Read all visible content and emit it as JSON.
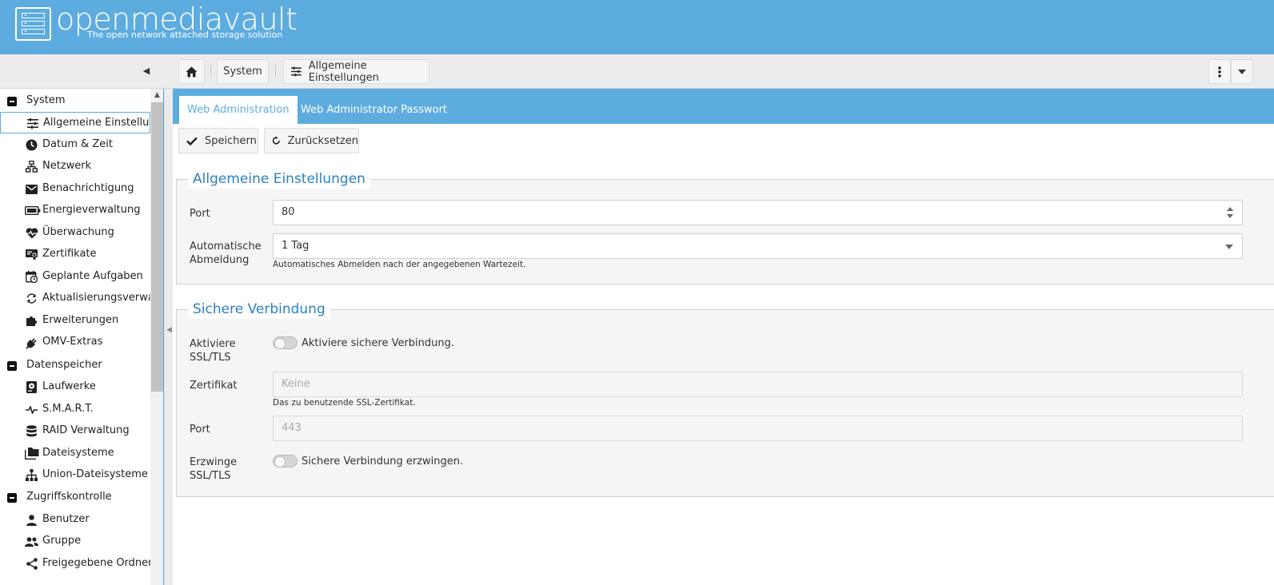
{
  "brand": {
    "name": "openmediavault",
    "tagline": "The open network attached storage solution"
  },
  "breadcrumb": {
    "section": "System",
    "page": "Allgemeine Einstellungen"
  },
  "sidebar": {
    "groups": [
      {
        "label": "System",
        "items": [
          {
            "label": "Allgemeine Einstellungen",
            "icon": "sliders-icon",
            "active": true
          },
          {
            "label": "Datum & Zeit",
            "icon": "clock-icon"
          },
          {
            "label": "Netzwerk",
            "icon": "network-icon"
          },
          {
            "label": "Benachrichtigung",
            "icon": "envelope-icon"
          },
          {
            "label": "Energieverwaltung",
            "icon": "battery-icon"
          },
          {
            "label": "Überwachung",
            "icon": "heartbeat-icon"
          },
          {
            "label": "Zertifikate",
            "icon": "certificate-icon"
          },
          {
            "label": "Geplante Aufgaben",
            "icon": "calendar-clock-icon"
          },
          {
            "label": "Aktualisierungsverwaltung",
            "icon": "refresh-icon"
          },
          {
            "label": "Erweiterungen",
            "icon": "puzzle-icon"
          },
          {
            "label": "OMV-Extras",
            "icon": "plug-icon"
          }
        ]
      },
      {
        "label": "Datenspeicher",
        "items": [
          {
            "label": "Laufwerke",
            "icon": "harddisk-icon"
          },
          {
            "label": "S.M.A.R.T.",
            "icon": "pulse-icon"
          },
          {
            "label": "RAID Verwaltung",
            "icon": "database-icon"
          },
          {
            "label": "Dateisysteme",
            "icon": "folders-icon"
          },
          {
            "label": "Union-Dateisysteme",
            "icon": "sitemap-icon"
          }
        ]
      },
      {
        "label": "Zugriffskontrolle",
        "items": [
          {
            "label": "Benutzer",
            "icon": "user-icon"
          },
          {
            "label": "Gruppe",
            "icon": "users-icon"
          },
          {
            "label": "Freigegebene Ordner",
            "icon": "share-icon"
          }
        ]
      }
    ]
  },
  "tabs": [
    "Web Administration",
    "Web Administrator Passwort"
  ],
  "actions": {
    "save": "Speichern",
    "reset": "Zurücksetzen"
  },
  "general": {
    "legend": "Allgemeine Einstellungen",
    "port_label": "Port",
    "port_value": "80",
    "logout_label_1": "Automatische",
    "logout_label_2": "Abmeldung",
    "logout_value": "1 Tag",
    "logout_hint": "Automatisches Abmelden nach der angegebenen Wartezeit."
  },
  "secure": {
    "legend": "Sichere Verbindung",
    "ssl_label_1": "Aktiviere",
    "ssl_label_2": "SSL/TLS",
    "ssl_toggle_text": "Aktiviere sichere Verbindung.",
    "ssl_enabled": false,
    "cert_label": "Zertifikat",
    "cert_placeholder": "Keine",
    "cert_hint": "Das zu benutzende SSL-Zertifikat.",
    "port_label": "Port",
    "port_placeholder": "443",
    "force_label_1": "Erzwinge",
    "force_label_2": "SSL/TLS",
    "force_toggle_text": "Sichere Verbindung erzwingen.",
    "force_enabled": false
  },
  "colors": {
    "accent": "#5dacdf",
    "legend": "#2b7fc0",
    "panel": "#f5f5f5"
  }
}
